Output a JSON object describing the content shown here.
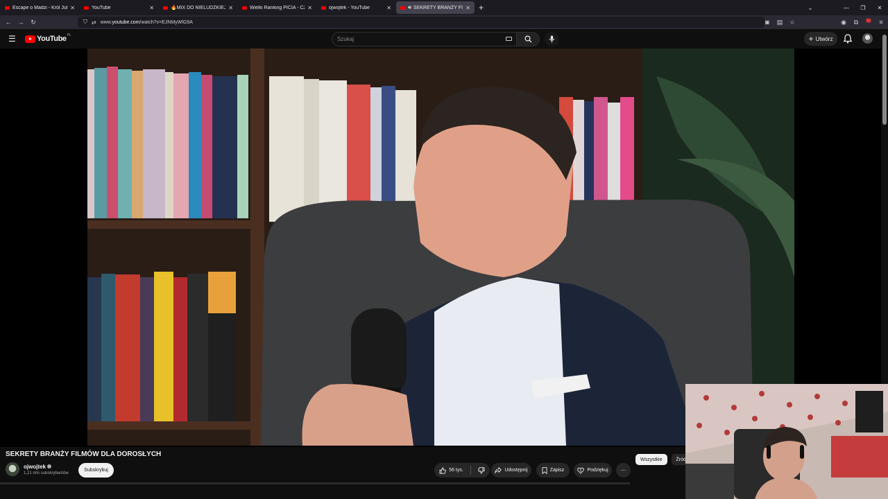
{
  "browser": {
    "tabs": [
      {
        "label": "Escape o Madzi - Król Julian & I",
        "active": false
      },
      {
        "label": "YouTube",
        "active": false
      },
      {
        "label": "🔥MIX DO NIELUDZKIEJ PRACY",
        "active": false
      },
      {
        "label": "Wielki Ranking PICIA - CZEGO N",
        "active": false
      },
      {
        "label": "ojwojtek - YouTube",
        "active": false
      },
      {
        "label": "SEKRETY BRANŻY FILMÓW",
        "active": true
      }
    ],
    "new_tab": "+",
    "url": {
      "prefix": "www.",
      "host": "youtube.com",
      "path": "/watch?v=EJNMyWlG9A"
    }
  },
  "youtube": {
    "logo_text": "YouTube",
    "region": "PL",
    "search_placeholder": "Szukaj",
    "create_label": "Utwórz"
  },
  "video": {
    "title": "SEKRETY BRANŻY FILMÓW DLA DOROSŁYCH",
    "channel": "ojwojtek",
    "subscribers": "1,21 mln subskrybentów",
    "subscribe_label": "Subskrybuj",
    "likes": "56 tys.",
    "share_label": "Udostępnij",
    "save_label": "Zapisz",
    "thanks_label": "Podziękuj",
    "more_label": "⋯"
  },
  "chips": [
    {
      "label": "Wszystkie",
      "active": true
    },
    {
      "label": "Źródł",
      "active": false
    }
  ],
  "colors": {
    "accent": "#ff0000",
    "background": "#0f0f0f",
    "pill": "#272727"
  }
}
